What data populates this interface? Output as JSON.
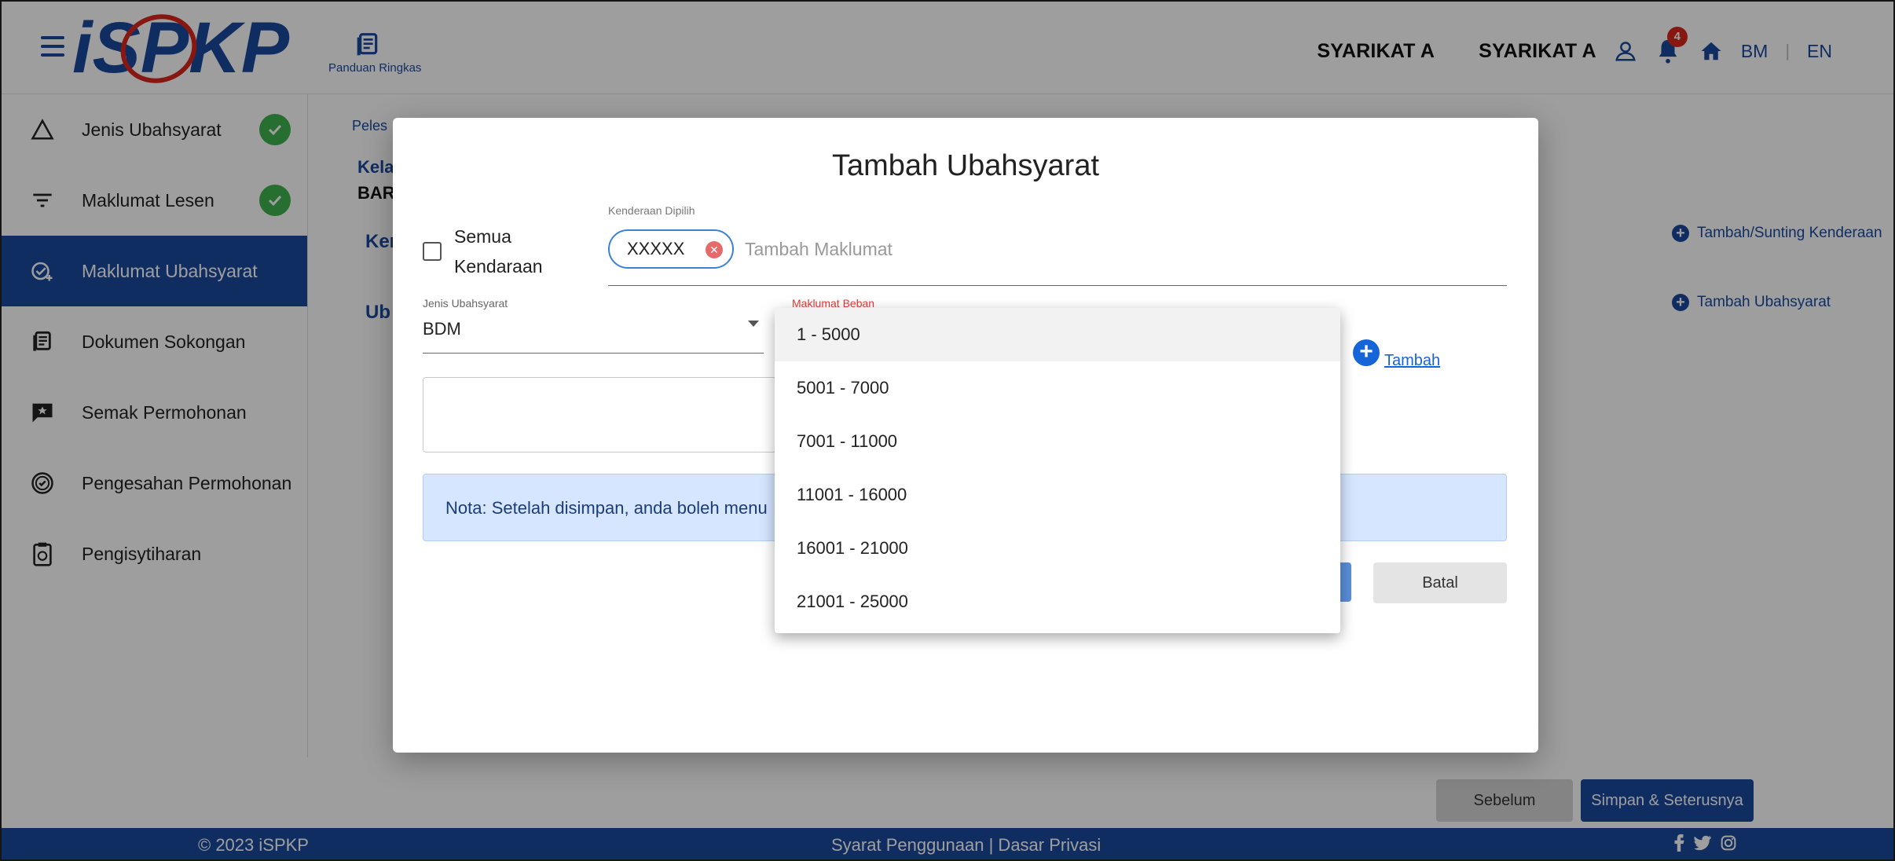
{
  "header": {
    "guide_label": "Panduan Ringkas",
    "company_1": "SYARIKAT A",
    "company_2": "SYARIKAT A",
    "notification_count": "4",
    "lang_bm": "BM",
    "lang_sep": "|",
    "lang_en": "EN"
  },
  "sidebar": {
    "items": [
      {
        "label": "Jenis Ubahsyarat",
        "icon": "triangle-icon",
        "done": true
      },
      {
        "label": "Maklumat Lesen",
        "icon": "filter-icon",
        "done": true
      },
      {
        "label": "Maklumat Ubahsyarat",
        "icon": "check-plus-icon",
        "active": true
      },
      {
        "label": "Dokumen Sokongan",
        "icon": "document-icon"
      },
      {
        "label": "Semak Permohonan",
        "icon": "chat-star-icon"
      },
      {
        "label": "Pengesahan Permohonan",
        "icon": "verified-icon"
      },
      {
        "label": "Pengisytiharan",
        "icon": "clipboard-icon"
      }
    ]
  },
  "main": {
    "breadcrumb": "Peles",
    "kela": "Kela",
    "bar": "BAR",
    "ken_label": "Ker",
    "ub_label": "Ub",
    "link_vehicle": "Tambah/Sunting Kenderaan",
    "link_ubahsyarat": "Tambah Ubahsyarat",
    "btn_prev": "Sebelum",
    "btn_next": "Simpan & Seterusnya"
  },
  "footer": {
    "copyright": "© 2023 iSPKP",
    "links": "Syarat Penggunaan | Dasar Privasi"
  },
  "modal": {
    "title": "Tambah Ubahsyarat",
    "all_vehicles_label": "Semua Kendaraan",
    "all_vehicles_checked": false,
    "vehicle_caption": "Kenderaan Dipilih",
    "vehicle_chip": "XXXXX",
    "vehicle_placeholder": "Tambah Maklumat",
    "jenis_caption": "Jenis Ubahsyarat",
    "jenis_value": "BDM",
    "maklumat_caption": "Maklumat Beban",
    "tambah_label": "Tambah",
    "note": "Nota: Setelah disimpan, anda boleh menu",
    "cancel_label": "Batal"
  },
  "dropdown": {
    "options": [
      "1 - 5000",
      "5001 - 7000",
      "7001 - 11000",
      "11001 - 16000",
      "16001 - 21000",
      "21001 - 25000"
    ],
    "highlighted_index": 0
  },
  "colors": {
    "primary": "#1b4a9e",
    "success": "#3fb34f",
    "badge": "#d9261c",
    "note_bg": "#d6e6ff"
  }
}
